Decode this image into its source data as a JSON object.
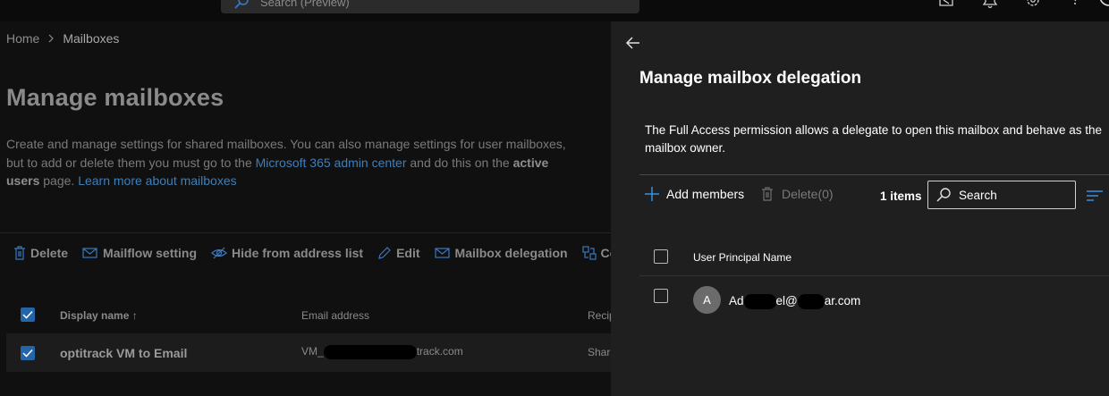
{
  "topbar": {
    "search_placeholder": "Search (Preview)"
  },
  "left_page": {
    "breadcrumb": [
      "Home",
      "Mailboxes"
    ],
    "title": "Manage mailboxes",
    "description": {
      "part1": "Create and manage settings for shared mailboxes. You can also manage settings for user mailboxes, but to add or delete them you must go to the ",
      "link1": "Microsoft 365 admin center",
      "part2": " and do this on the ",
      "bold": "active users",
      "part3": " page. ",
      "link2": "Learn more about mailboxes"
    },
    "toolbar": {
      "delete": "Delete",
      "mailflow": "Mailflow setting",
      "hide": "Hide from address list",
      "edit": "Edit",
      "delegation": "Mailbox delegation",
      "convert": "Conve"
    },
    "columns": {
      "display_name": "Display name",
      "sort_arrow": "↑",
      "email": "Email address",
      "recipient": "Recip"
    },
    "rows": [
      {
        "display_name": "optitrack VM to Email",
        "email_start": "VM_",
        "email_end": "track.com",
        "recipient": "Shar"
      }
    ]
  },
  "panel": {
    "title": "Manage mailbox delegation",
    "description": "The Full Access permission allows a delegate to open this mailbox and behave as the mailbox owner.",
    "add_members": "Add members",
    "delete": "Delete(0)",
    "count": "1 items",
    "search_placeholder": "Search",
    "column_upn": "User Principal Name",
    "members": [
      {
        "initial": "A",
        "upn_a": "Ad",
        "upn_b": "el@",
        "upn_c": "ar.com"
      }
    ]
  },
  "colors": {
    "accent": "#2464a8",
    "link": "#3f7fb8",
    "panel_bg": "#1f1f1f",
    "page_bg": "#101010"
  }
}
